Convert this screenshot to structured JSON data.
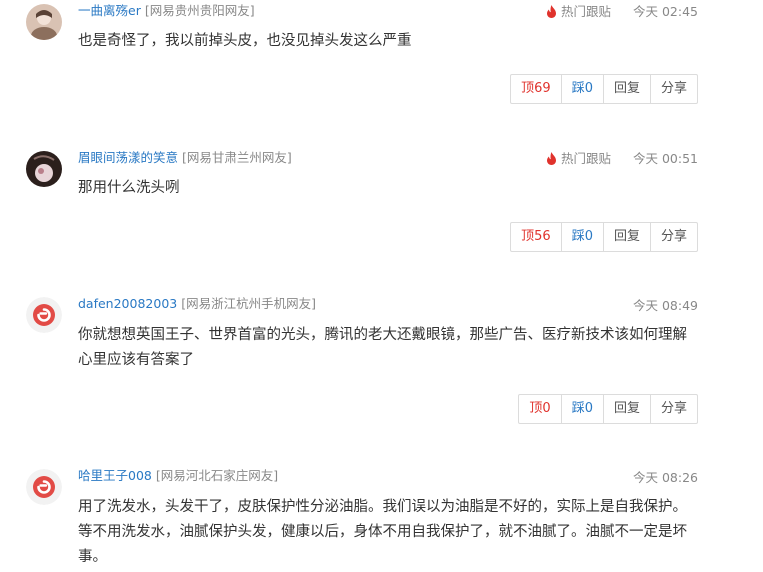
{
  "comments": [
    {
      "username": "一曲离殇er",
      "location": "[网易贵州贵阳网友]",
      "hot_label": "热门跟贴",
      "show_hot": true,
      "time": "今天 02:45",
      "text": "也是奇怪了，我以前掉头皮，也没见掉头发这么严重",
      "up_label": "顶69",
      "down_label": "踩0",
      "reply_label": "回复",
      "share_label": "分享",
      "avatar": "photo-avatar"
    },
    {
      "username": "眉眼间荡漾的笑意",
      "location": "[网易甘肃兰州网友]",
      "hot_label": "热门跟贴",
      "show_hot": true,
      "time": "今天 00:51",
      "text": "那用什么洗头咧",
      "up_label": "顶56",
      "down_label": "踩0",
      "reply_label": "回复",
      "share_label": "分享",
      "avatar": "photo-avatar-dark"
    },
    {
      "username": "dafen20082003",
      "location": "[网易浙江杭州手机网友]",
      "hot_label": "",
      "show_hot": false,
      "time": "今天 08:49",
      "text": "你就想想英国王子、世界首富的光头，腾讯的老大还戴眼镜，那些广告、医疗新技术该如何理解心里应该有答案了",
      "up_label": "顶0",
      "down_label": "踩0",
      "reply_label": "回复",
      "share_label": "分享",
      "avatar": "netease-default-avatar"
    },
    {
      "username": "哈里王子008",
      "location": "[网易河北石家庄网友]",
      "hot_label": "",
      "show_hot": false,
      "time": "今天 08:26",
      "text": "用了洗发水，头发干了，皮肤保护性分泌油脂。我们误以为油脂是不好的，实际上是自我保护。等不用洗发水，油腻保护头发，健康以后，身体不用自我保护了，就不油腻了。油腻不一定是坏事。",
      "up_label": "",
      "down_label": "",
      "reply_label": "",
      "share_label": "",
      "avatar": "netease-default-avatar"
    }
  ],
  "colors": {
    "username": "#2a79c4",
    "upvote": "#e0322c",
    "downvote": "#2a79c4",
    "hot_flame": "#e0322c",
    "meta_gray": "#888888"
  }
}
